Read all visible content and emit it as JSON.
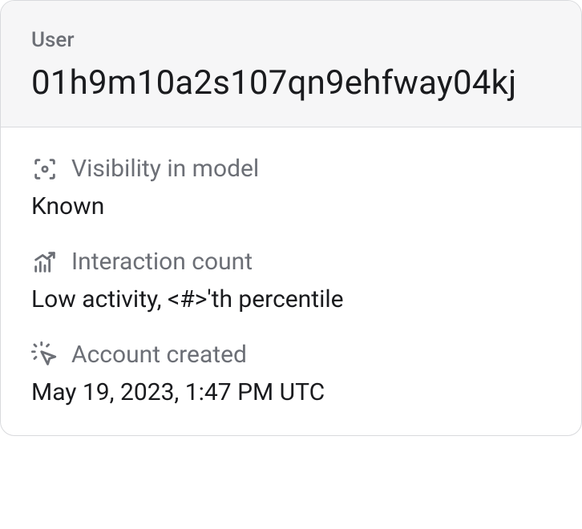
{
  "header": {
    "label": "User",
    "value": "01h9m10a2s107qn9ehfway04kj"
  },
  "rows": {
    "visibility": {
      "label": "Visibility in model",
      "value": "Known"
    },
    "interaction": {
      "label": "Interaction count",
      "value": "Low activity,  <#>'th percentile"
    },
    "created": {
      "label": "Account created",
      "value": "May 19, 2023, 1:47 PM UTC"
    }
  }
}
